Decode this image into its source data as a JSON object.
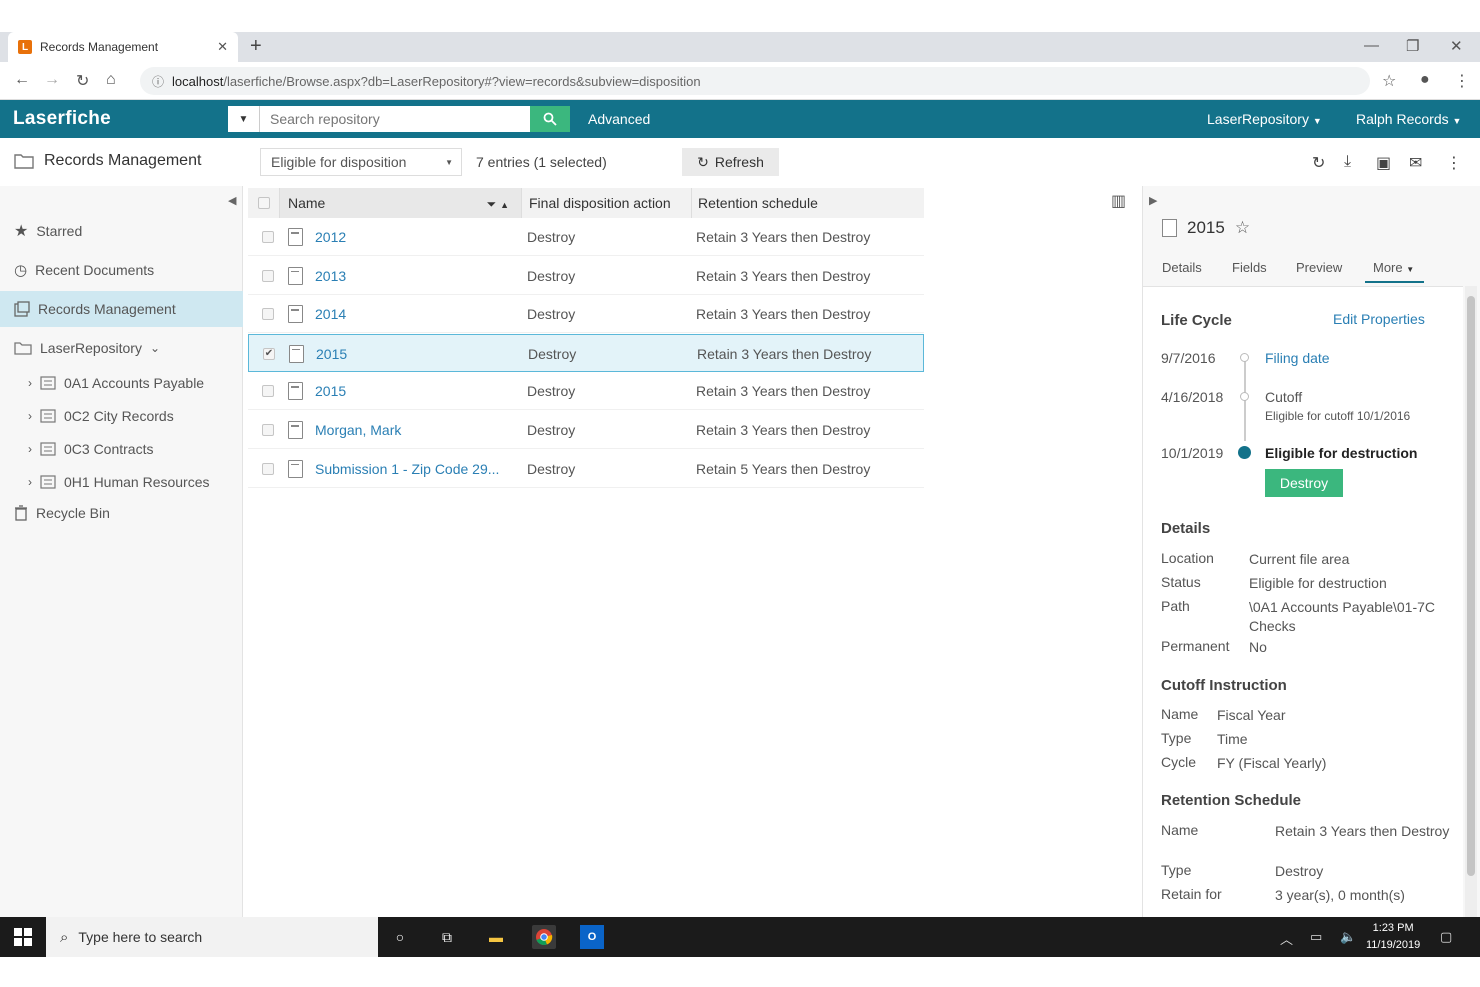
{
  "browser": {
    "tab_title": "Records Management",
    "tab_favicon": "L",
    "url_host": "localhost",
    "url_path": "/laserfiche/Browse.aspx?db=LaserRepository#?view=records&subview=disposition"
  },
  "app": {
    "logo": "Laserfiche",
    "search_placeholder": "Search repository",
    "advanced_label": "Advanced",
    "repo_menu": "LaserRepository",
    "user_menu": "Ralph Records",
    "accent": "#13728a",
    "green": "#3bb77e"
  },
  "toolbar": {
    "page_title": "Records Management",
    "view_select": "Eligible for disposition",
    "entries": "7 entries (1 selected)",
    "refresh_label": "Refresh"
  },
  "sidebar": {
    "items": [
      {
        "label": "Starred",
        "icon": "star-icon"
      },
      {
        "label": "Recent Documents",
        "icon": "clock-icon"
      },
      {
        "label": "Records Management",
        "icon": "records-icon"
      },
      {
        "label": "LaserRepository",
        "icon": "folder-icon"
      }
    ],
    "sub_items": [
      {
        "label": "0A1 Accounts Payable"
      },
      {
        "label": "0C2 City Records"
      },
      {
        "label": "0C3 Contracts"
      },
      {
        "label": "0H1 Human Resources"
      }
    ],
    "recycle_bin": "Recycle Bin"
  },
  "list": {
    "columns": [
      "Name",
      "Final disposition action",
      "Retention schedule"
    ],
    "rows": [
      {
        "name": "2012",
        "action": "Destroy",
        "schedule": "Retain 3 Years then Destroy",
        "checked": false
      },
      {
        "name": "2013",
        "action": "Destroy",
        "schedule": "Retain 3 Years then Destroy",
        "checked": false
      },
      {
        "name": "2014",
        "action": "Destroy",
        "schedule": "Retain 3 Years then Destroy",
        "checked": false
      },
      {
        "name": "2015",
        "action": "Destroy",
        "schedule": "Retain 3 Years then Destroy",
        "checked": true
      },
      {
        "name": "2015",
        "action": "Destroy",
        "schedule": "Retain 3 Years then Destroy",
        "checked": false
      },
      {
        "name": "Morgan, Mark",
        "action": "Destroy",
        "schedule": "Retain 3 Years then Destroy",
        "checked": false
      },
      {
        "name": "Submission 1 - Zip Code 29...",
        "action": "Destroy",
        "schedule": "Retain 5 Years then Destroy",
        "checked": false
      }
    ]
  },
  "details": {
    "title": "2015",
    "tabs": [
      "Details",
      "Fields",
      "Preview",
      "More"
    ],
    "lifecycle_title": "Life Cycle",
    "edit_properties": "Edit Properties",
    "lifecycle": [
      {
        "date": "9/7/2016",
        "label": "Filing date",
        "sub": ""
      },
      {
        "date": "4/16/2018",
        "label": "Cutoff",
        "sub": "Eligible for cutoff 10/1/2016"
      },
      {
        "date": "10/1/2019",
        "label": "Eligible for destruction",
        "sub": ""
      }
    ],
    "destroy_button": "Destroy",
    "details_title": "Details",
    "details_fields": [
      {
        "label": "Location",
        "value": "Current file area"
      },
      {
        "label": "Status",
        "value": "Eligible for destruction"
      },
      {
        "label": "Path",
        "value": "\\0A1 Accounts Payable\\01-7C Checks"
      },
      {
        "label": "Permanent",
        "value": "No"
      }
    ],
    "cutoff_title": "Cutoff Instruction",
    "cutoff_fields": [
      {
        "label": "Name",
        "value": "Fiscal Year"
      },
      {
        "label": "Type",
        "value": "Time"
      },
      {
        "label": "Cycle",
        "value": "FY (Fiscal Yearly)"
      }
    ],
    "retention_title": "Retention Schedule",
    "retention_fields": [
      {
        "label": "Name",
        "value": "Retain 3 Years then Destroy"
      },
      {
        "label": "Type",
        "value": "Destroy"
      },
      {
        "label": "Retain for",
        "value": "3 year(s), 0 month(s)"
      }
    ]
  },
  "taskbar": {
    "search_placeholder": "Type here to search",
    "time": "1:23 PM",
    "date": "11/19/2019"
  }
}
